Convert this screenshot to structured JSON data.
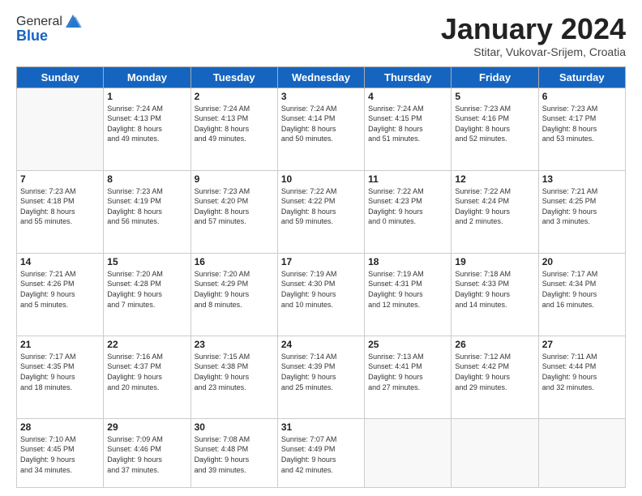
{
  "header": {
    "logo_general": "General",
    "logo_blue": "Blue",
    "month_title": "January 2024",
    "subtitle": "Stitar, Vukovar-Srijem, Croatia"
  },
  "weekdays": [
    "Sunday",
    "Monday",
    "Tuesday",
    "Wednesday",
    "Thursday",
    "Friday",
    "Saturday"
  ],
  "weeks": [
    [
      {
        "day": "",
        "info": ""
      },
      {
        "day": "1",
        "info": "Sunrise: 7:24 AM\nSunset: 4:13 PM\nDaylight: 8 hours\nand 49 minutes."
      },
      {
        "day": "2",
        "info": "Sunrise: 7:24 AM\nSunset: 4:13 PM\nDaylight: 8 hours\nand 49 minutes."
      },
      {
        "day": "3",
        "info": "Sunrise: 7:24 AM\nSunset: 4:14 PM\nDaylight: 8 hours\nand 50 minutes."
      },
      {
        "day": "4",
        "info": "Sunrise: 7:24 AM\nSunset: 4:15 PM\nDaylight: 8 hours\nand 51 minutes."
      },
      {
        "day": "5",
        "info": "Sunrise: 7:23 AM\nSunset: 4:16 PM\nDaylight: 8 hours\nand 52 minutes."
      },
      {
        "day": "6",
        "info": "Sunrise: 7:23 AM\nSunset: 4:17 PM\nDaylight: 8 hours\nand 53 minutes."
      }
    ],
    [
      {
        "day": "7",
        "info": "Sunrise: 7:23 AM\nSunset: 4:18 PM\nDaylight: 8 hours\nand 55 minutes."
      },
      {
        "day": "8",
        "info": "Sunrise: 7:23 AM\nSunset: 4:19 PM\nDaylight: 8 hours\nand 56 minutes."
      },
      {
        "day": "9",
        "info": "Sunrise: 7:23 AM\nSunset: 4:20 PM\nDaylight: 8 hours\nand 57 minutes."
      },
      {
        "day": "10",
        "info": "Sunrise: 7:22 AM\nSunset: 4:22 PM\nDaylight: 8 hours\nand 59 minutes."
      },
      {
        "day": "11",
        "info": "Sunrise: 7:22 AM\nSunset: 4:23 PM\nDaylight: 9 hours\nand 0 minutes."
      },
      {
        "day": "12",
        "info": "Sunrise: 7:22 AM\nSunset: 4:24 PM\nDaylight: 9 hours\nand 2 minutes."
      },
      {
        "day": "13",
        "info": "Sunrise: 7:21 AM\nSunset: 4:25 PM\nDaylight: 9 hours\nand 3 minutes."
      }
    ],
    [
      {
        "day": "14",
        "info": "Sunrise: 7:21 AM\nSunset: 4:26 PM\nDaylight: 9 hours\nand 5 minutes."
      },
      {
        "day": "15",
        "info": "Sunrise: 7:20 AM\nSunset: 4:28 PM\nDaylight: 9 hours\nand 7 minutes."
      },
      {
        "day": "16",
        "info": "Sunrise: 7:20 AM\nSunset: 4:29 PM\nDaylight: 9 hours\nand 8 minutes."
      },
      {
        "day": "17",
        "info": "Sunrise: 7:19 AM\nSunset: 4:30 PM\nDaylight: 9 hours\nand 10 minutes."
      },
      {
        "day": "18",
        "info": "Sunrise: 7:19 AM\nSunset: 4:31 PM\nDaylight: 9 hours\nand 12 minutes."
      },
      {
        "day": "19",
        "info": "Sunrise: 7:18 AM\nSunset: 4:33 PM\nDaylight: 9 hours\nand 14 minutes."
      },
      {
        "day": "20",
        "info": "Sunrise: 7:17 AM\nSunset: 4:34 PM\nDaylight: 9 hours\nand 16 minutes."
      }
    ],
    [
      {
        "day": "21",
        "info": "Sunrise: 7:17 AM\nSunset: 4:35 PM\nDaylight: 9 hours\nand 18 minutes."
      },
      {
        "day": "22",
        "info": "Sunrise: 7:16 AM\nSunset: 4:37 PM\nDaylight: 9 hours\nand 20 minutes."
      },
      {
        "day": "23",
        "info": "Sunrise: 7:15 AM\nSunset: 4:38 PM\nDaylight: 9 hours\nand 23 minutes."
      },
      {
        "day": "24",
        "info": "Sunrise: 7:14 AM\nSunset: 4:39 PM\nDaylight: 9 hours\nand 25 minutes."
      },
      {
        "day": "25",
        "info": "Sunrise: 7:13 AM\nSunset: 4:41 PM\nDaylight: 9 hours\nand 27 minutes."
      },
      {
        "day": "26",
        "info": "Sunrise: 7:12 AM\nSunset: 4:42 PM\nDaylight: 9 hours\nand 29 minutes."
      },
      {
        "day": "27",
        "info": "Sunrise: 7:11 AM\nSunset: 4:44 PM\nDaylight: 9 hours\nand 32 minutes."
      }
    ],
    [
      {
        "day": "28",
        "info": "Sunrise: 7:10 AM\nSunset: 4:45 PM\nDaylight: 9 hours\nand 34 minutes."
      },
      {
        "day": "29",
        "info": "Sunrise: 7:09 AM\nSunset: 4:46 PM\nDaylight: 9 hours\nand 37 minutes."
      },
      {
        "day": "30",
        "info": "Sunrise: 7:08 AM\nSunset: 4:48 PM\nDaylight: 9 hours\nand 39 minutes."
      },
      {
        "day": "31",
        "info": "Sunrise: 7:07 AM\nSunset: 4:49 PM\nDaylight: 9 hours\nand 42 minutes."
      },
      {
        "day": "",
        "info": ""
      },
      {
        "day": "",
        "info": ""
      },
      {
        "day": "",
        "info": ""
      }
    ]
  ]
}
